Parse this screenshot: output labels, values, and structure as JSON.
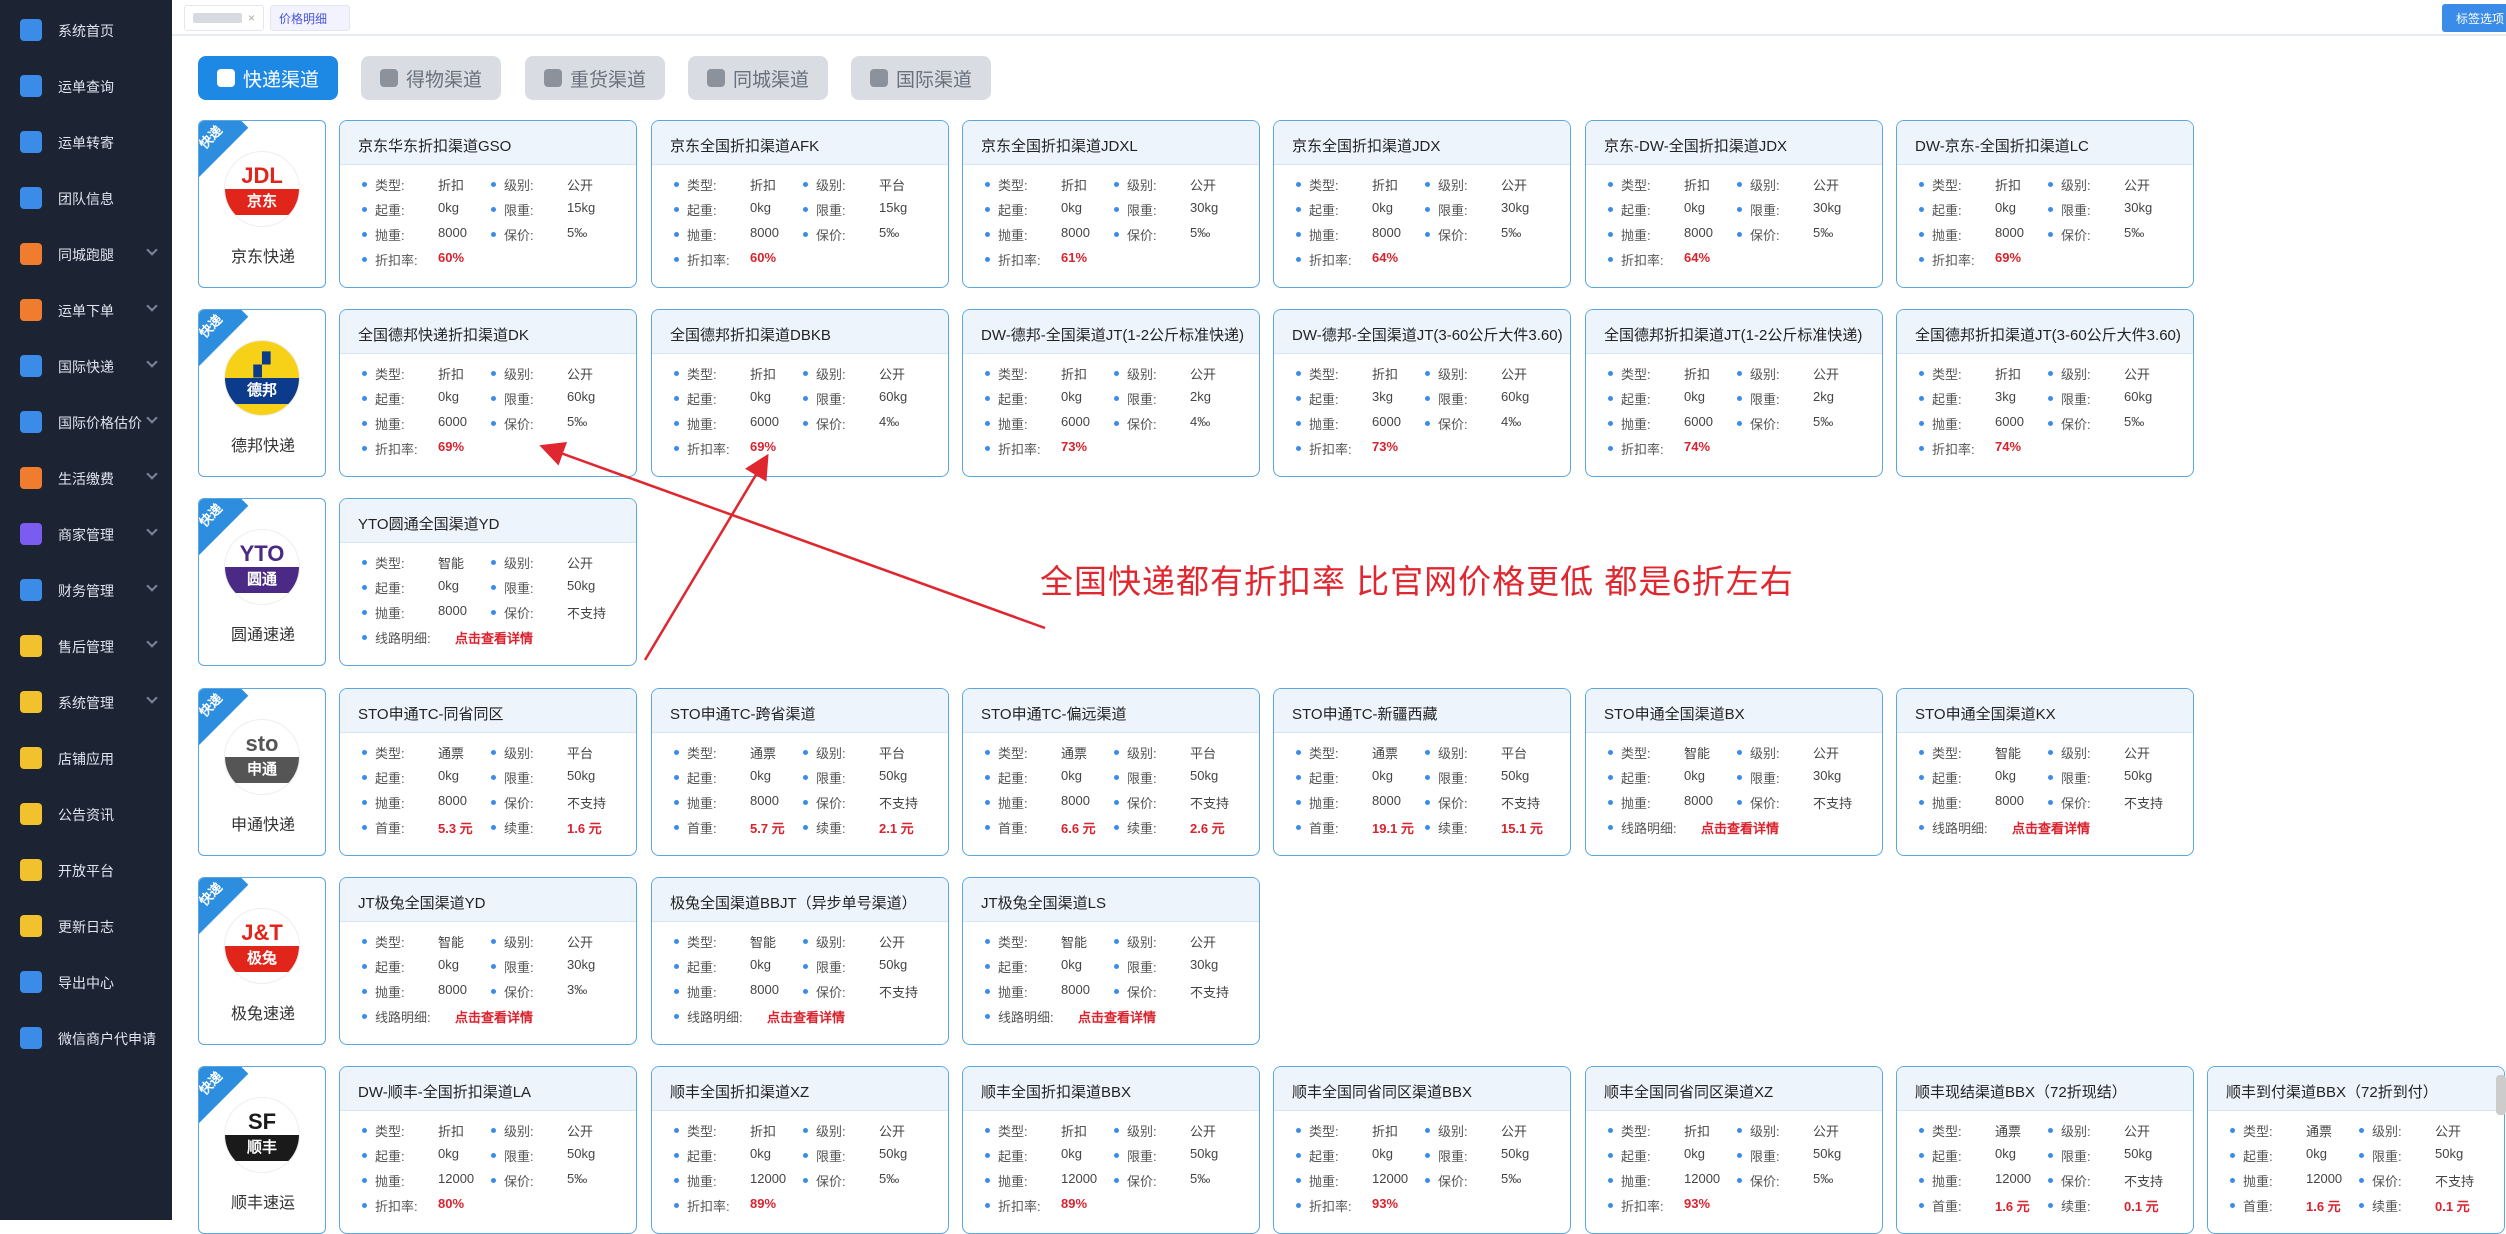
{
  "sidebar": {
    "items": [
      {
        "label": "系统首页",
        "icon": "home-icon",
        "color": "#3b8ce8",
        "chevron": false
      },
      {
        "label": "运单查询",
        "icon": "search-doc-icon",
        "color": "#3b8ce8",
        "chevron": false
      },
      {
        "label": "运单转寄",
        "icon": "forward-doc-icon",
        "color": "#3b8ce8",
        "chevron": false
      },
      {
        "label": "团队信息",
        "icon": "team-icon",
        "color": "#3b8ce8",
        "chevron": false
      },
      {
        "label": "同城跑腿",
        "icon": "truck-icon",
        "color": "#f07c2e",
        "chevron": true
      },
      {
        "label": "运单下单",
        "icon": "truck-icon",
        "color": "#f07c2e",
        "chevron": true
      },
      {
        "label": "国际快递",
        "icon": "layers-icon",
        "color": "#3b8ce8",
        "chevron": true
      },
      {
        "label": "国际价格估价",
        "icon": "layers-icon",
        "color": "#3b8ce8",
        "chevron": true
      },
      {
        "label": "生活缴费",
        "icon": "flame-icon",
        "color": "#f07c2e",
        "chevron": true
      },
      {
        "label": "商家管理",
        "icon": "shop-icon",
        "color": "#7b5cf0",
        "chevron": true
      },
      {
        "label": "财务管理",
        "icon": "wallet-icon",
        "color": "#3b8ce8",
        "chevron": true
      },
      {
        "label": "售后管理",
        "icon": "shield-icon",
        "color": "#f2c12e",
        "chevron": true
      },
      {
        "label": "系统管理",
        "icon": "gear-icon",
        "color": "#f2c12e",
        "chevron": true
      },
      {
        "label": "店铺应用",
        "icon": "grid-icon",
        "color": "#f2c12e",
        "chevron": false
      },
      {
        "label": "公告资讯",
        "icon": "megaphone-icon",
        "color": "#f2c12e",
        "chevron": false
      },
      {
        "label": "开放平台",
        "icon": "grid-icon",
        "color": "#f2c12e",
        "chevron": false
      },
      {
        "label": "更新日志",
        "icon": "shield-check-icon",
        "color": "#f2c12e",
        "chevron": false
      },
      {
        "label": "导出中心",
        "icon": "export-icon",
        "color": "#3b8ce8",
        "chevron": false
      },
      {
        "label": "微信商户代申请",
        "icon": "doc-icon",
        "color": "#3b8ce8",
        "chevron": false
      }
    ]
  },
  "topbar": {
    "tab_close": "×",
    "active_tab": "价格明细",
    "right_button": "标签选项"
  },
  "channel_tabs": [
    {
      "label": "快递渠道",
      "icon": "box-icon",
      "active": true
    },
    {
      "label": "得物渠道",
      "icon": "dewu-icon",
      "active": false
    },
    {
      "label": "重货渠道",
      "icon": "weight-icon",
      "active": false
    },
    {
      "label": "同城渠道",
      "icon": "truck-icon",
      "active": false
    },
    {
      "label": "国际渠道",
      "icon": "lock-icon",
      "active": false
    }
  ],
  "labels": {
    "type": "类型:",
    "level": "级别:",
    "start_weight": "起重:",
    "limit_weight": "限重:",
    "volumetric": "抛重:",
    "insurance": "保价:",
    "discount": "折扣率:",
    "route": "线路明细:",
    "first_weight": "首重:",
    "extra_weight": "续重:",
    "corner": "快递"
  },
  "carriers": [
    {
      "name": "京东快递",
      "logo_text": [
        "JDL",
        "京东"
      ],
      "logo_colors": [
        "#e1251b",
        "#ffffff"
      ],
      "cards": [
        {
          "title": "京东华东折扣渠道GSO",
          "type": "折扣",
          "level": "公开",
          "start": "0kg",
          "limit": "15kg",
          "vol": "8000",
          "ins": "5‰",
          "last_kind": "discount",
          "last": "60%"
        },
        {
          "title": "京东全国折扣渠道AFK",
          "type": "折扣",
          "level": "平台",
          "start": "0kg",
          "limit": "15kg",
          "vol": "8000",
          "ins": "5‰",
          "last_kind": "discount",
          "last": "60%"
        },
        {
          "title": "京东全国折扣渠道JDXL",
          "type": "折扣",
          "level": "公开",
          "start": "0kg",
          "limit": "30kg",
          "vol": "8000",
          "ins": "5‰",
          "last_kind": "discount",
          "last": "61%"
        },
        {
          "title": "京东全国折扣渠道JDX",
          "type": "折扣",
          "level": "公开",
          "start": "0kg",
          "limit": "30kg",
          "vol": "8000",
          "ins": "5‰",
          "last_kind": "discount",
          "last": "64%"
        },
        {
          "title": "京东-DW-全国折扣渠道JDX",
          "type": "折扣",
          "level": "公开",
          "start": "0kg",
          "limit": "30kg",
          "vol": "8000",
          "ins": "5‰",
          "last_kind": "discount",
          "last": "64%"
        },
        {
          "title": "DW-京东-全国折扣渠道LC",
          "type": "折扣",
          "level": "公开",
          "start": "0kg",
          "limit": "30kg",
          "vol": "8000",
          "ins": "5‰",
          "last_kind": "discount",
          "last": "69%"
        }
      ]
    },
    {
      "name": "德邦快递",
      "logo_text": [
        "▞",
        "德邦"
      ],
      "logo_colors": [
        "#0d3b8c",
        "#f7d117"
      ],
      "cards": [
        {
          "title": "全国德邦快递折扣渠道DK",
          "type": "折扣",
          "level": "公开",
          "start": "0kg",
          "limit": "60kg",
          "vol": "6000",
          "ins": "5‰",
          "last_kind": "discount",
          "last": "69%"
        },
        {
          "title": "全国德邦折扣渠道DBKB",
          "type": "折扣",
          "level": "公开",
          "start": "0kg",
          "limit": "60kg",
          "vol": "6000",
          "ins": "4‰",
          "last_kind": "discount",
          "last": "69%"
        },
        {
          "title": "DW-德邦-全国渠道JT(1-2公斤标准快递)",
          "type": "折扣",
          "level": "公开",
          "start": "0kg",
          "limit": "2kg",
          "vol": "6000",
          "ins": "4‰",
          "last_kind": "discount",
          "last": "73%"
        },
        {
          "title": "DW-德邦-全国渠道JT(3-60公斤大件3.60)",
          "type": "折扣",
          "level": "公开",
          "start": "3kg",
          "limit": "60kg",
          "vol": "6000",
          "ins": "4‰",
          "last_kind": "discount",
          "last": "73%"
        },
        {
          "title": "全国德邦折扣渠道JT(1-2公斤标准快递)",
          "type": "折扣",
          "level": "公开",
          "start": "0kg",
          "limit": "2kg",
          "vol": "6000",
          "ins": "5‰",
          "last_kind": "discount",
          "last": "74%"
        },
        {
          "title": "全国德邦折扣渠道JT(3-60公斤大件3.60)",
          "type": "折扣",
          "level": "公开",
          "start": "3kg",
          "limit": "60kg",
          "vol": "6000",
          "ins": "5‰",
          "last_kind": "discount",
          "last": "74%"
        }
      ]
    },
    {
      "name": "圆通速递",
      "logo_text": [
        "YTO",
        "圆通"
      ],
      "logo_colors": [
        "#4b2a85",
        "#ffffff"
      ],
      "cards": [
        {
          "title": "YTO圆通全国渠道YD",
          "type": "智能",
          "level": "公开",
          "start": "0kg",
          "limit": "50kg",
          "vol": "8000",
          "ins": "不支持",
          "last_kind": "route",
          "last": "点击查看详情"
        }
      ]
    },
    {
      "name": "申通快递",
      "logo_text": [
        "sto",
        "申通"
      ],
      "logo_colors": [
        "#555555",
        "#ffffff"
      ],
      "cards": [
        {
          "title": "STO申通TC-同省同区",
          "type": "通票",
          "level": "平台",
          "start": "0kg",
          "limit": "50kg",
          "vol": "8000",
          "ins": "不支持",
          "last_kind": "price",
          "first": "5.3 元",
          "extra": "1.6 元"
        },
        {
          "title": "STO申通TC-跨省渠道",
          "type": "通票",
          "level": "平台",
          "start": "0kg",
          "limit": "50kg",
          "vol": "8000",
          "ins": "不支持",
          "last_kind": "price",
          "first": "5.7 元",
          "extra": "2.1 元"
        },
        {
          "title": "STO申通TC-偏远渠道",
          "type": "通票",
          "level": "平台",
          "start": "0kg",
          "limit": "50kg",
          "vol": "8000",
          "ins": "不支持",
          "last_kind": "price",
          "first": "6.6 元",
          "extra": "2.6 元"
        },
        {
          "title": "STO申通TC-新疆西藏",
          "type": "通票",
          "level": "平台",
          "start": "0kg",
          "limit": "50kg",
          "vol": "8000",
          "ins": "不支持",
          "last_kind": "price",
          "first": "19.1 元",
          "extra": "15.1 元"
        },
        {
          "title": "STO申通全国渠道BX",
          "type": "智能",
          "level": "公开",
          "start": "0kg",
          "limit": "30kg",
          "vol": "8000",
          "ins": "不支持",
          "last_kind": "route",
          "last": "点击查看详情"
        },
        {
          "title": "STO申通全国渠道KX",
          "type": "智能",
          "level": "公开",
          "start": "0kg",
          "limit": "50kg",
          "vol": "8000",
          "ins": "不支持",
          "last_kind": "route",
          "last": "点击查看详情"
        }
      ]
    },
    {
      "name": "极兔速递",
      "logo_text": [
        "J&T",
        "极兔"
      ],
      "logo_colors": [
        "#e1251b",
        "#ffffff"
      ],
      "cards": [
        {
          "title": "JT极兔全国渠道YD",
          "type": "智能",
          "level": "公开",
          "start": "0kg",
          "limit": "30kg",
          "vol": "8000",
          "ins": "3‰",
          "last_kind": "route",
          "last": "点击查看详情"
        },
        {
          "title": "极兔全国渠道BBJT（异步单号渠道）",
          "type": "智能",
          "level": "公开",
          "start": "0kg",
          "limit": "50kg",
          "vol": "8000",
          "ins": "不支持",
          "last_kind": "route",
          "last": "点击查看详情"
        },
        {
          "title": "JT极兔全国渠道LS",
          "type": "智能",
          "level": "公开",
          "start": "0kg",
          "limit": "30kg",
          "vol": "8000",
          "ins": "不支持",
          "last_kind": "route",
          "last": "点击查看详情"
        }
      ]
    },
    {
      "name": "顺丰速运",
      "logo_text": [
        "SF",
        "顺丰"
      ],
      "logo_colors": [
        "#1a1a1a",
        "#ffffff"
      ],
      "cards": [
        {
          "title": "DW-顺丰-全国折扣渠道LA",
          "type": "折扣",
          "level": "公开",
          "start": "0kg",
          "limit": "50kg",
          "vol": "12000",
          "ins": "5‰",
          "last_kind": "discount",
          "last": "80%"
        },
        {
          "title": "顺丰全国折扣渠道XZ",
          "type": "折扣",
          "level": "公开",
          "start": "0kg",
          "limit": "50kg",
          "vol": "12000",
          "ins": "5‰",
          "last_kind": "discount",
          "last": "89%"
        },
        {
          "title": "顺丰全国折扣渠道BBX",
          "type": "折扣",
          "level": "公开",
          "start": "0kg",
          "limit": "50kg",
          "vol": "12000",
          "ins": "5‰",
          "last_kind": "discount",
          "last": "89%"
        },
        {
          "title": "顺丰全国同省同区渠道BBX",
          "type": "折扣",
          "level": "公开",
          "start": "0kg",
          "limit": "50kg",
          "vol": "12000",
          "ins": "5‰",
          "last_kind": "discount",
          "last": "93%"
        },
        {
          "title": "顺丰全国同省同区渠道XZ",
          "type": "折扣",
          "level": "公开",
          "start": "0kg",
          "limit": "50kg",
          "vol": "12000",
          "ins": "5‰",
          "last_kind": "discount",
          "last": "93%"
        },
        {
          "title": "顺丰现结渠道BBX（72折现结）",
          "type": "通票",
          "level": "公开",
          "start": "0kg",
          "limit": "50kg",
          "vol": "12000",
          "ins": "不支持",
          "last_kind": "price",
          "first": "1.6 元",
          "extra": "0.1 元"
        },
        {
          "title": "顺丰到付渠道BBX（72折到付）",
          "type": "通票",
          "level": "公开",
          "start": "0kg",
          "limit": "50kg",
          "vol": "12000",
          "ins": "不支持",
          "last_kind": "price",
          "first": "1.6 元",
          "extra": "0.1 元"
        }
      ]
    }
  ],
  "annotation": "全国快递都有折扣率   比官网价格更低   都是6折左右",
  "colors": {
    "accent": "#1e88e5",
    "card_border": "#5ba7df",
    "highlight": "#d9232e",
    "sidebar_bg": "#1c2433"
  }
}
